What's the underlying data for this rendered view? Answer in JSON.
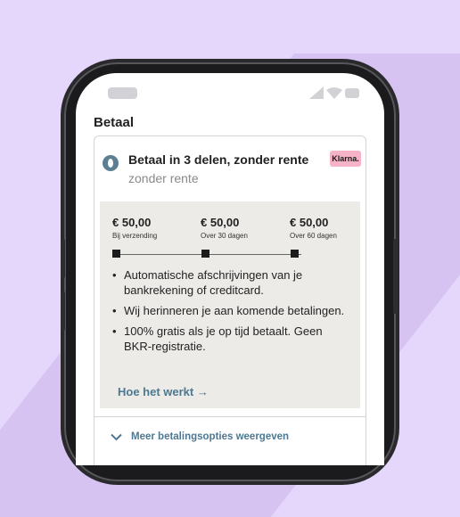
{
  "section_title": "Betaal",
  "option": {
    "title": "Betaal in 3 delen, zonder rente",
    "subtitle": "zonder rente",
    "brand_badge": "Klarna."
  },
  "installments": [
    {
      "amount": "€ 50,00",
      "label": "Bij verzending"
    },
    {
      "amount": "€ 50,00",
      "label": "Over 30 dagen"
    },
    {
      "amount": "€ 50,00",
      "label": "Over 60 dagen"
    }
  ],
  "bullets": [
    "Automatische afschrijvingen van je bankrekening of creditcard.",
    "Wij herinneren je aan komende betalingen.",
    "100% gratis als je op tijd betaalt. Geen BKR-registratie."
  ],
  "how_it_works": "Hoe het werkt →",
  "more_options": "Meer betalingsopties weergeven",
  "colors": {
    "background": "#e5d6fb",
    "accent": "#4d7891",
    "klarna_pink": "#f6b3c7",
    "panel": "#ecebe8"
  },
  "icons": [
    "radio-selected-icon",
    "signal-icon",
    "wifi-icon",
    "battery-icon",
    "chevron-down-icon",
    "arrow-right-icon"
  ]
}
